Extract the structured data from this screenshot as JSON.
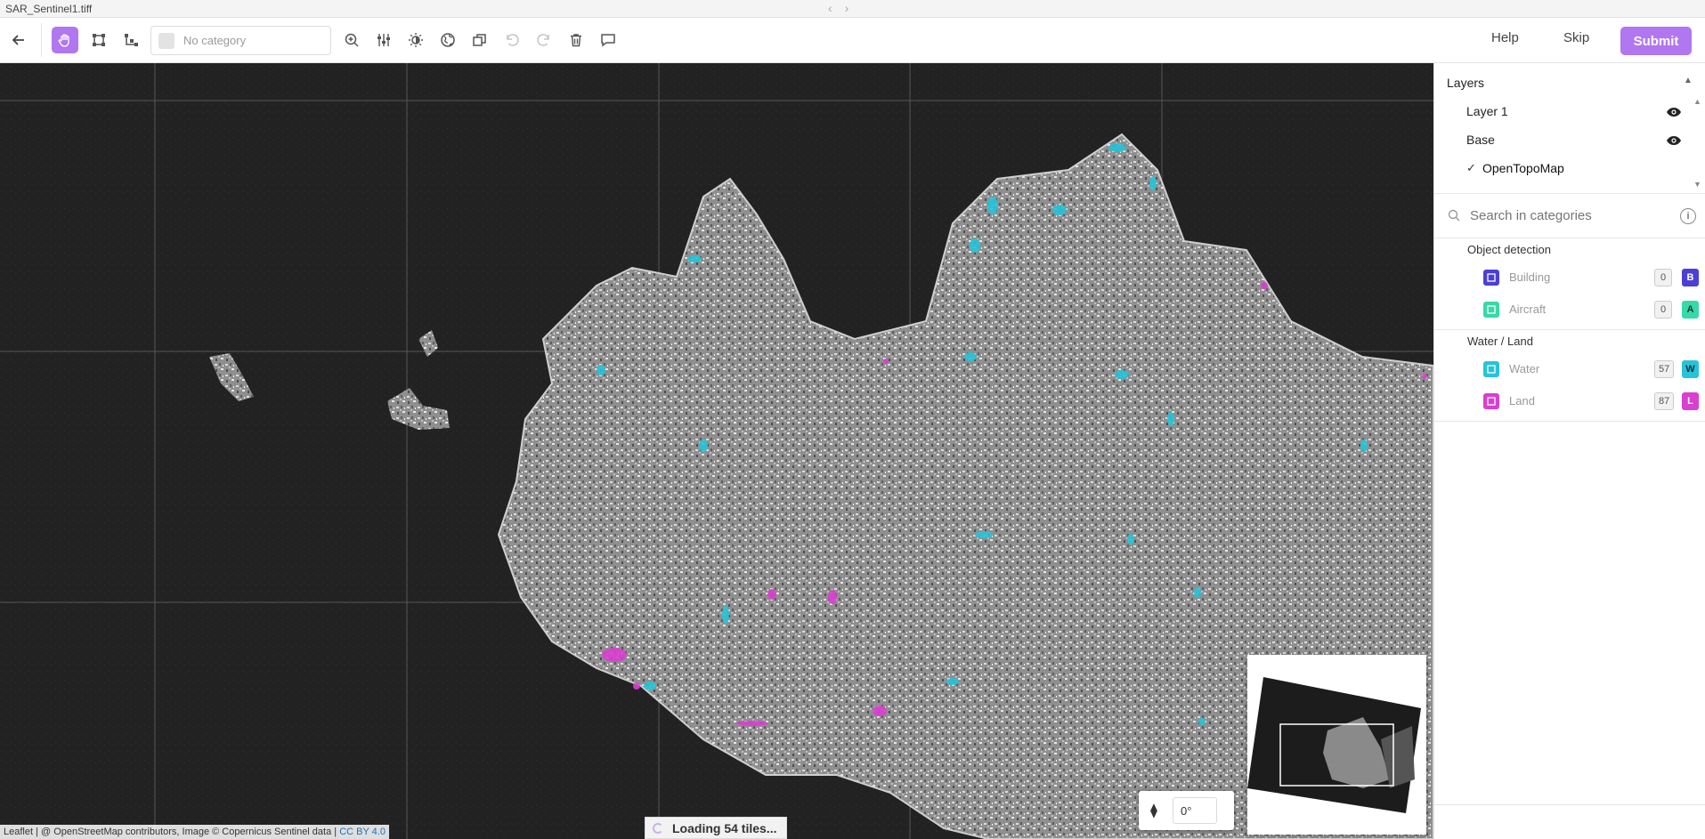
{
  "window": {
    "title": "SAR_Sentinel1.tiff",
    "nav_back_icon": "chevron-left-icon",
    "nav_forward_icon": "chevron-right-icon"
  },
  "toolbar": {
    "category_placeholder": "No category",
    "help_label": "Help",
    "skip_label": "Skip",
    "submit_label": "Submit",
    "accent_color": "#b077f0"
  },
  "map": {
    "attribution_text": "Leaflet | @ OpenStreetMap contributors, Image © Copernicus Sentinel data |",
    "attribution_link": "CC BY 4.0",
    "loading_text": "Loading 54 tiles...",
    "rotation_value": "0°"
  },
  "layers": {
    "title": "Layers",
    "items": [
      {
        "label": "Layer 1",
        "visible": true
      },
      {
        "label": "Base",
        "visible": true
      },
      {
        "label": "OpenTopoMap",
        "selected": true
      }
    ]
  },
  "categories": {
    "search_placeholder": "Search in categories",
    "groups": [
      {
        "title": "Object detection",
        "items": [
          {
            "label": "Building",
            "count": "0",
            "hotkey": "B",
            "color": "#4b3fd6"
          },
          {
            "label": "Aircraft",
            "count": "0",
            "hotkey": "A",
            "color": "#36d9a8"
          }
        ]
      },
      {
        "title": "Water / Land",
        "items": [
          {
            "label": "Water",
            "count": "57",
            "hotkey": "W",
            "color": "#27c3d8"
          },
          {
            "label": "Land",
            "count": "87",
            "hotkey": "L",
            "color": "#d93fd0"
          }
        ]
      }
    ]
  }
}
